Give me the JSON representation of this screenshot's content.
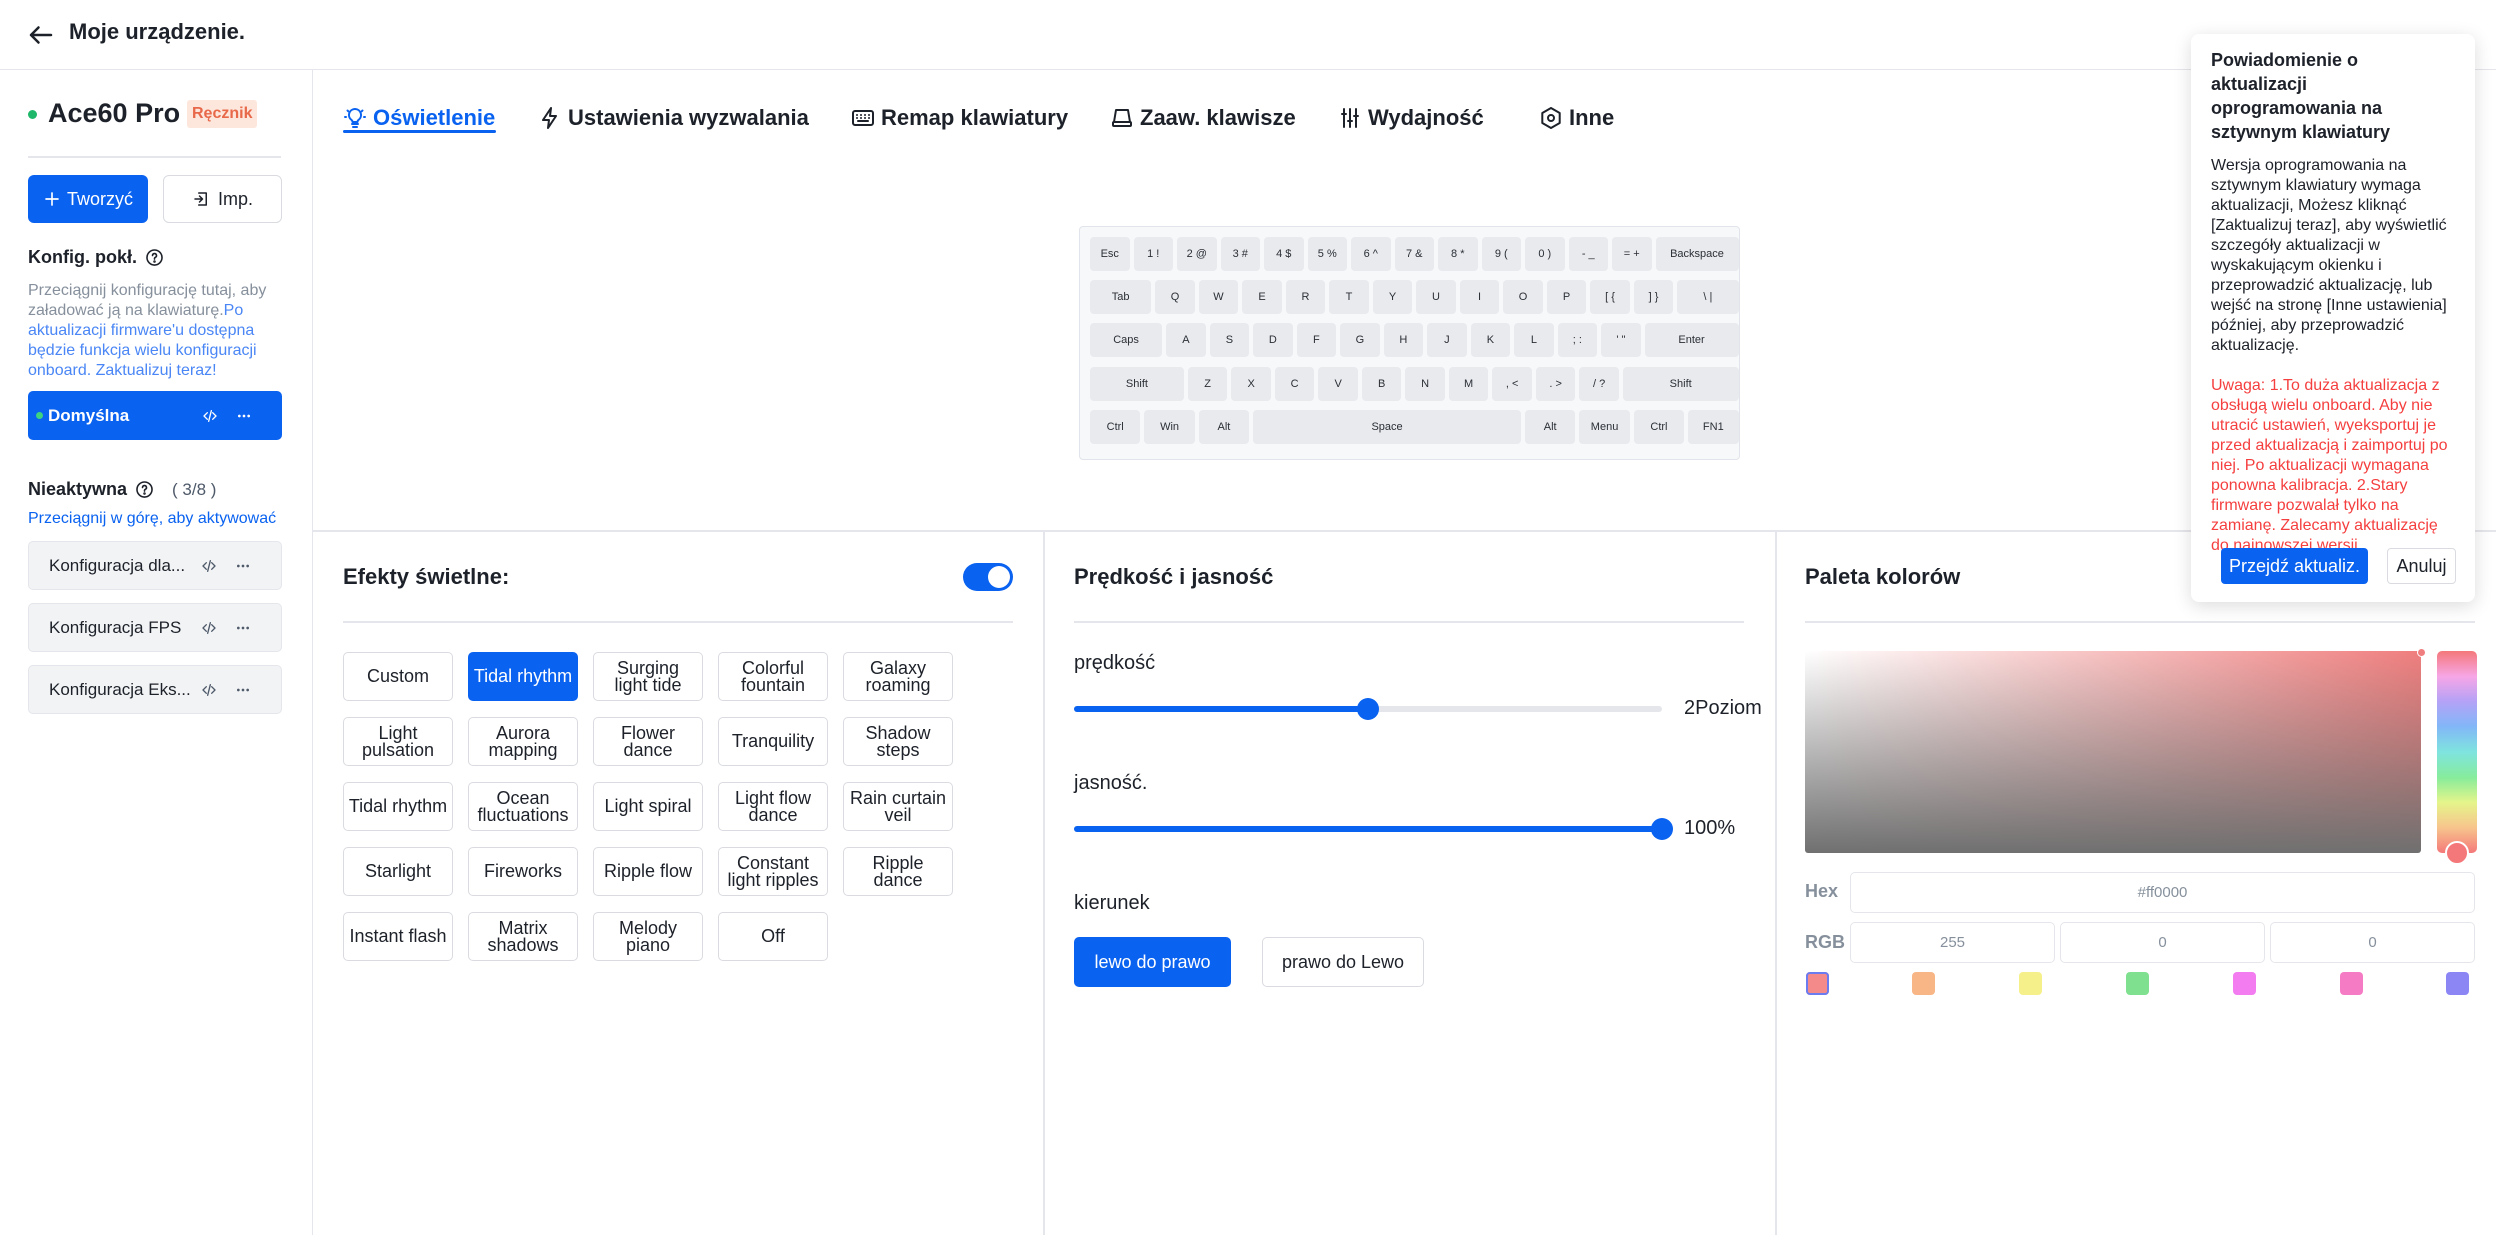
{
  "header": {
    "title": "Moje urządzenie.",
    "back_icon": "arrow-left-icon"
  },
  "sidebar": {
    "device_name": "Ace60 Pro",
    "device_badge": "Ręcznik",
    "create_label": "Tworzyć",
    "import_label": "Imp.",
    "onboard_title": "Konfig. pokł.",
    "onboard_desc": "Przeciągnij konfigurację tutaj, aby załadować ją na klawiaturę.",
    "onboard_link": "Po aktualizacji firmware'u dostępna będzie funkcja wielu konfiguracji onboard. Zaktualizuj teraz!",
    "active_config": "Domyślna",
    "inactive_title": "Nieaktywna",
    "inactive_count": "( 3/8 )",
    "drag_hint": "Przeciągnij w górę, aby aktywować",
    "inactive_configs": [
      "Konfiguracja dla...",
      "Konfiguracja FPS",
      "Konfiguracja Eks..."
    ]
  },
  "tabs": [
    {
      "label": "Oświetlenie",
      "icon": "bulb-icon",
      "active": true
    },
    {
      "label": "Ustawienia wyzwalania",
      "icon": "lightning-icon",
      "active": false
    },
    {
      "label": "Remap klawiatury",
      "icon": "keyboard-icon",
      "active": false
    },
    {
      "label": "Zaaw. klawisze",
      "icon": "keycap-icon",
      "active": false
    },
    {
      "label": "Wydajność",
      "icon": "sliders-icon",
      "active": false
    },
    {
      "label": "Inne",
      "icon": "hexagon-gear-icon",
      "active": false
    }
  ],
  "keyboard": {
    "rows": [
      [
        "Esc",
        "1 !",
        "2 @",
        "3 #",
        "4 $",
        "5 %",
        "6 ^",
        "7 &",
        "8 *",
        "9 (",
        "0 )",
        "- _",
        "= +",
        "Backspace"
      ],
      [
        "Tab",
        "Q",
        "W",
        "E",
        "R",
        "T",
        "Y",
        "U",
        "I",
        "O",
        "P",
        "[ {",
        "] }",
        "\\ |"
      ],
      [
        "Caps",
        "A",
        "S",
        "D",
        "F",
        "G",
        "H",
        "J",
        "K",
        "L",
        "; :",
        "' \"",
        "Enter"
      ],
      [
        "Shift",
        "Z",
        "X",
        "C",
        "V",
        "B",
        "N",
        "M",
        ", <",
        ". >",
        "/ ?",
        "Shift"
      ],
      [
        "Ctrl",
        "Win",
        "Alt",
        "Space",
        "Alt",
        "Menu",
        "Ctrl",
        "FN1"
      ]
    ]
  },
  "effects_panel": {
    "title": "Efekty świetlne:",
    "enabled": true,
    "selected": "Tidal rhythm",
    "effects": [
      "Custom",
      "Tidal rhythm",
      "Surging light tide",
      "Colorful fountain",
      "Galaxy roaming",
      "Light pulsation",
      "Aurora mapping",
      "Flower dance",
      "Tranquility",
      "Shadow steps",
      "Tidal rhythm",
      "Ocean fluctuations",
      "Light spiral",
      "Light flow dance",
      "Rain curtain veil",
      "Starlight",
      "Fireworks",
      "Ripple flow",
      "Constant light ripples",
      "Ripple dance",
      "Instant flash",
      "Matrix shadows",
      "Melody piano",
      "Off"
    ]
  },
  "speed_panel": {
    "title": "Prędkość i jasność",
    "speed_label": "prędkość",
    "speed_value_text": "2Poziom",
    "speed_fraction": 0.5,
    "brightness_label": "jasność.",
    "brightness_value_text": "100%",
    "brightness_fraction": 1.0,
    "direction_label": "kierunek",
    "direction_left_right": "lewo do prawo",
    "direction_right_left": "prawo do Lewo",
    "direction_selected": "lewo do prawo"
  },
  "palette_panel": {
    "title": "Paleta kolorów",
    "hex_label": "Hex",
    "hex_value": "#ff0000",
    "rgb_label": "RGB",
    "r": "255",
    "g": "0",
    "b": "0",
    "swatches": [
      "#f48a8a",
      "#f8b686",
      "#f6f08a",
      "#7fe08f",
      "#f27cf0",
      "#f57bc4",
      "#8c86f5"
    ],
    "active_swatch": 0
  },
  "notification": {
    "title": "Powiadomienie o aktualizacji oprogramowania na sztywnym klawiatury",
    "body": "Wersja oprogramowania na sztywnym klawiatury wymaga aktualizacji, Możesz kliknąć [Zaktualizuj teraz], aby wyświetlić szczegóły aktualizacji w wyskakującym okienku i przeprowadzić aktualizację, lub wejść na stronę [Inne ustawienia] później, aby przeprowadzić aktualizację.",
    "warning": "Uwaga: 1.To duża aktualizacja z obsługą wielu onboard. Aby nie utracić ustawień, wyeksportuj je przed aktualizacją i zaimportuj po niej. Po aktualizacji wymagana ponowna kalibracja. 2.Stary firmware pozwalał tylko na zamianę. Zalecamy aktualizację do najnowszej wersji.",
    "primary_label": "Przejdź aktualiz.",
    "cancel_label": "Anuluj"
  },
  "colors": {
    "accent": "#0a62f0",
    "warning": "#f53f3f",
    "status_green": "#1fb86a"
  }
}
